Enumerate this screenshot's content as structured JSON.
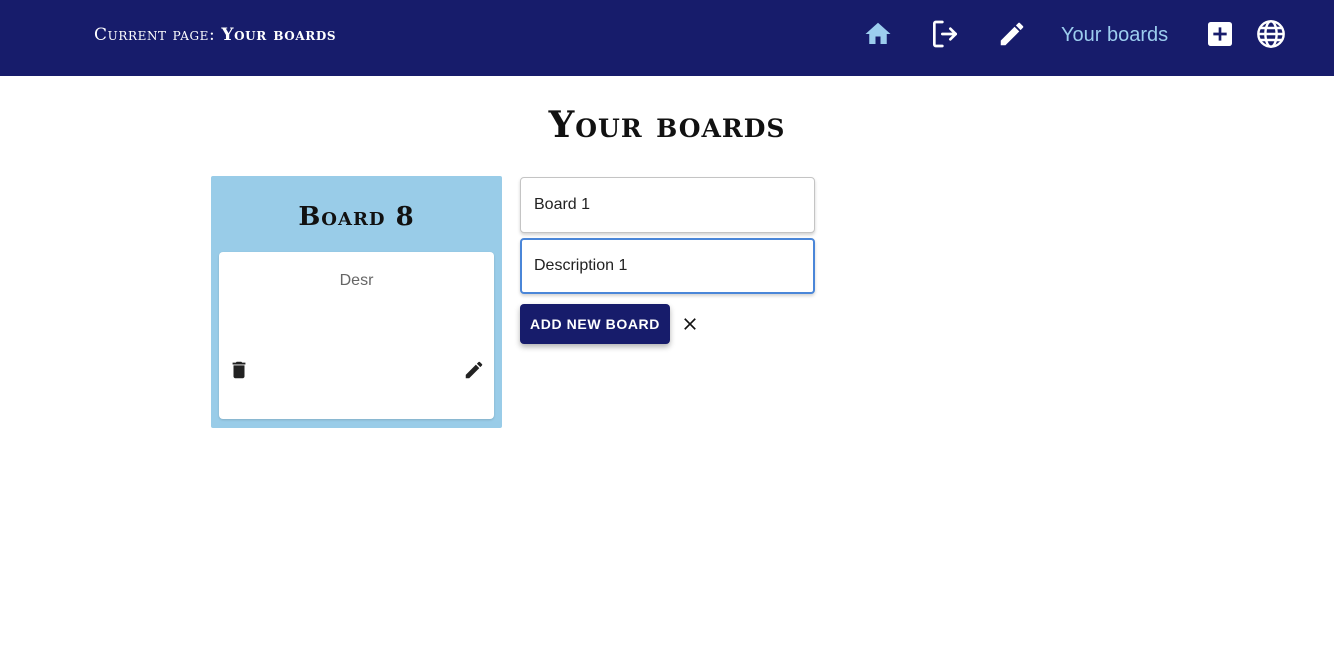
{
  "header": {
    "current_page_label": "Current page:",
    "current_page_name": "Your boards",
    "nav_icons": {
      "home": "home-icon",
      "logout": "logout-icon",
      "edit": "pencil-icon",
      "add": "add-box-icon",
      "language": "globe-icon"
    },
    "nav_link_label": "Your boards",
    "colors": {
      "background": "#171c6b",
      "accent": "#9ccdee"
    }
  },
  "main": {
    "title": "Your boards",
    "boards": [
      {
        "title": "Board 8",
        "description": "Desr",
        "delete_icon": "trash-icon",
        "edit_icon": "pencil-icon",
        "color": "#99cce8"
      }
    ],
    "form": {
      "name_value": "Board 1",
      "description_value": "Description 1",
      "submit_label": "Add new board",
      "close_icon": "close-icon"
    }
  }
}
